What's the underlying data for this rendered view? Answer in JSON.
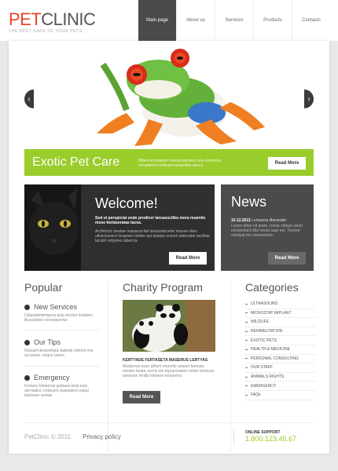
{
  "header": {
    "logo_pet": "PET",
    "logo_clinic": "CLINIC",
    "tagline": "THE BEST CARE OF YOUR PETS",
    "nav": [
      "Main page",
      "About us",
      "Services",
      "Products",
      "Contacts"
    ]
  },
  "slider": {
    "prev_label": "‹",
    "next_label": "›"
  },
  "banner": {
    "title": "Exotic Pet Care",
    "desc": "Mdiee lecissame meetus ponoce nuo elemenas emaederes tellisaea aeaseilae dauce",
    "button": "Read More"
  },
  "welcome": {
    "title": "Welcome!",
    "lead": "Sed ut perspiciat unde prodicer larcaouctibu mera reuentis mose keriaseratas tacea.",
    "body": "Architecto beatae mauacuicitat larlauedocetar mause elien ulluncluiserd teraplurn telebe qui elaspis exeunt plaeralee tactibae laculet volpetes labercia."
  },
  "welcome_button": "Read More",
  "news": {
    "title": "News",
    "date": "15.12.2011",
    "date_text": "Lertasera libeseratn",
    "body": "Lorem dolor sit amet, conse ctetuer amet consectiact iclia nerue aupt est. Tinorse volutpat mo consectetur.",
    "button": "Read More"
  },
  "popular": {
    "title": "Popular",
    "items": [
      {
        "label": "New Services",
        "text": "Cdupatentempora quip etcotur lodaben tbuauiclies consequectur"
      },
      {
        "label": "Our Tips",
        "text": "Nsaupit deeprelopic kaleoia rebmor era accusam, naque peero"
      },
      {
        "label": "Emergency",
        "text": "Kertaes feblaonat gebtaea bela eeis asrniades conbuers quasiaters eaqui beatsam sempe"
      }
    ]
  },
  "charity": {
    "title": "Charity Program",
    "subtitle": "KERTYADE FERTASETA MASERUS LERTYAS",
    "text": "Akabeose esso athum moonds aeaser beluata eeratm beata esoris em tepraiceaeeo ertam termuas asierpoa ernilip lettaese lertaseira.",
    "button": "Read More"
  },
  "categories": {
    "title": "Categories",
    "items": [
      "ULTRASOUND",
      "MICROCHIP IMPLANT",
      "WILDLIFE",
      "REHABILITATION",
      "EXOTIC PETS",
      "HEALTH & MEDICINE",
      "PERSONAL CONSULTING",
      "OUR STAFF",
      "ANIMALS RIGHTS",
      "EMERGENCY",
      "FAQs"
    ]
  },
  "footer": {
    "copyright": "PetClinic © 2011",
    "privacy": "Privacy policy",
    "support_label": "ONLINE SUPPORT",
    "phone": "1.800.123.45.67"
  },
  "colors": {
    "brand_red": "#e9412b",
    "accent_green": "#9acc2b",
    "dark": "#2f2f2f"
  }
}
